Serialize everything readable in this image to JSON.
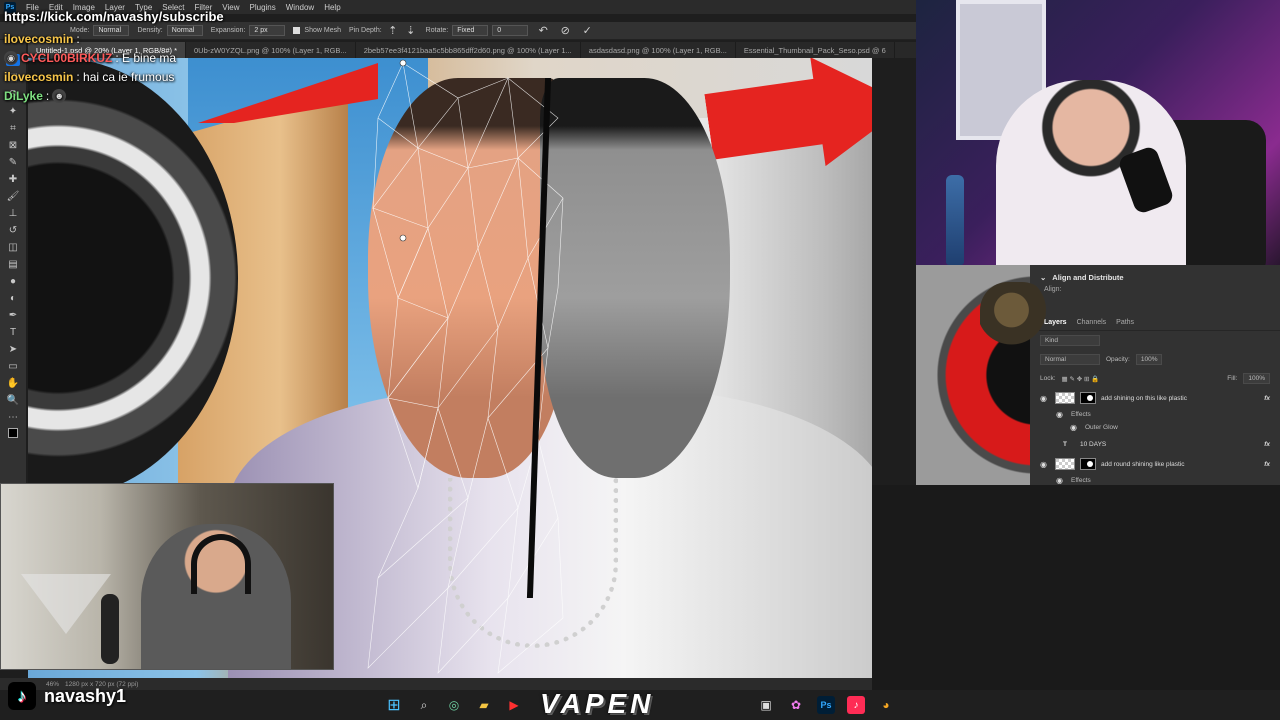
{
  "photoshop": {
    "menu": [
      "File",
      "Edit",
      "Image",
      "Layer",
      "Type",
      "Select",
      "Filter",
      "View",
      "Plugins",
      "Window",
      "Help"
    ],
    "options": {
      "mode_label": "Mode:",
      "mode_value": "Normal",
      "density_label": "Density:",
      "density_value": "Normal",
      "expansion_label": "Expansion:",
      "expansion_value": "2 px",
      "show_mesh_label": "Show Mesh",
      "pin_depth_label": "Pin Depth:",
      "rotate_label": "Rotate:",
      "rotate_value": "Fixed",
      "rotate_angle": "0"
    },
    "tabs": [
      "Untitled-1.psd @ 20% (Layer 1, RGB/8#) *",
      "0Ub-zW0YZQL.png @ 100% (Layer 1, RGB...",
      "2beb57ee3f4121baa5c5bb865dff2d60.png @ 100% (Layer 1...",
      "asdasdasd.png @ 100% (Layer 1, RGB...",
      "Essential_Thumbnail_Pack_Seso.psd @ 6"
    ],
    "status_text": "1280 px x 720 px (72 ppi)",
    "status_zoom": "46%"
  },
  "stream": {
    "subscribe_url": "https://kick.com/navashy/subscribe",
    "chat": [
      {
        "user": "ilovecosmin",
        "user_color": "#f7c64a",
        "message": ":"
      },
      {
        "user": "CYCL00BIRKUZ",
        "user_color": "#ff5a5a",
        "message": ": E bine ma"
      },
      {
        "user": "ilovecosmin",
        "user_color": "#f7c64a",
        "message": ": hai ca ie frumous"
      },
      {
        "user": "DiLyke",
        "user_color": "#7ee081",
        "message": ":"
      }
    ],
    "tiktok_handle": "navashy1",
    "sponsor": "VAPEN"
  },
  "layers_panel": {
    "align_title": "Align and Distribute",
    "align_sub": "Align:",
    "tabs": [
      "Layers",
      "Channels",
      "Paths"
    ],
    "kind_placeholder": "Kind",
    "blend_mode": "Normal",
    "opacity_label": "Opacity:",
    "opacity_value": "100%",
    "lock_label": "Lock:",
    "fill_label": "Fill:",
    "fill_value": "100%",
    "layers": [
      {
        "name": "add shining on this like plastic",
        "fx": "fx",
        "effects": "Effects",
        "effect": "Outer Glow"
      },
      {
        "name": "10 DAYS",
        "fx": "fx"
      },
      {
        "name": "add round shining like plastic",
        "fx": "fx",
        "effects": "Effects"
      }
    ]
  },
  "taskbar": {
    "icons": [
      "windows-start",
      "search",
      "copilot",
      "file-explorer",
      "youtube",
      "edge",
      "ps",
      "tiktok",
      "ms-store"
    ]
  }
}
